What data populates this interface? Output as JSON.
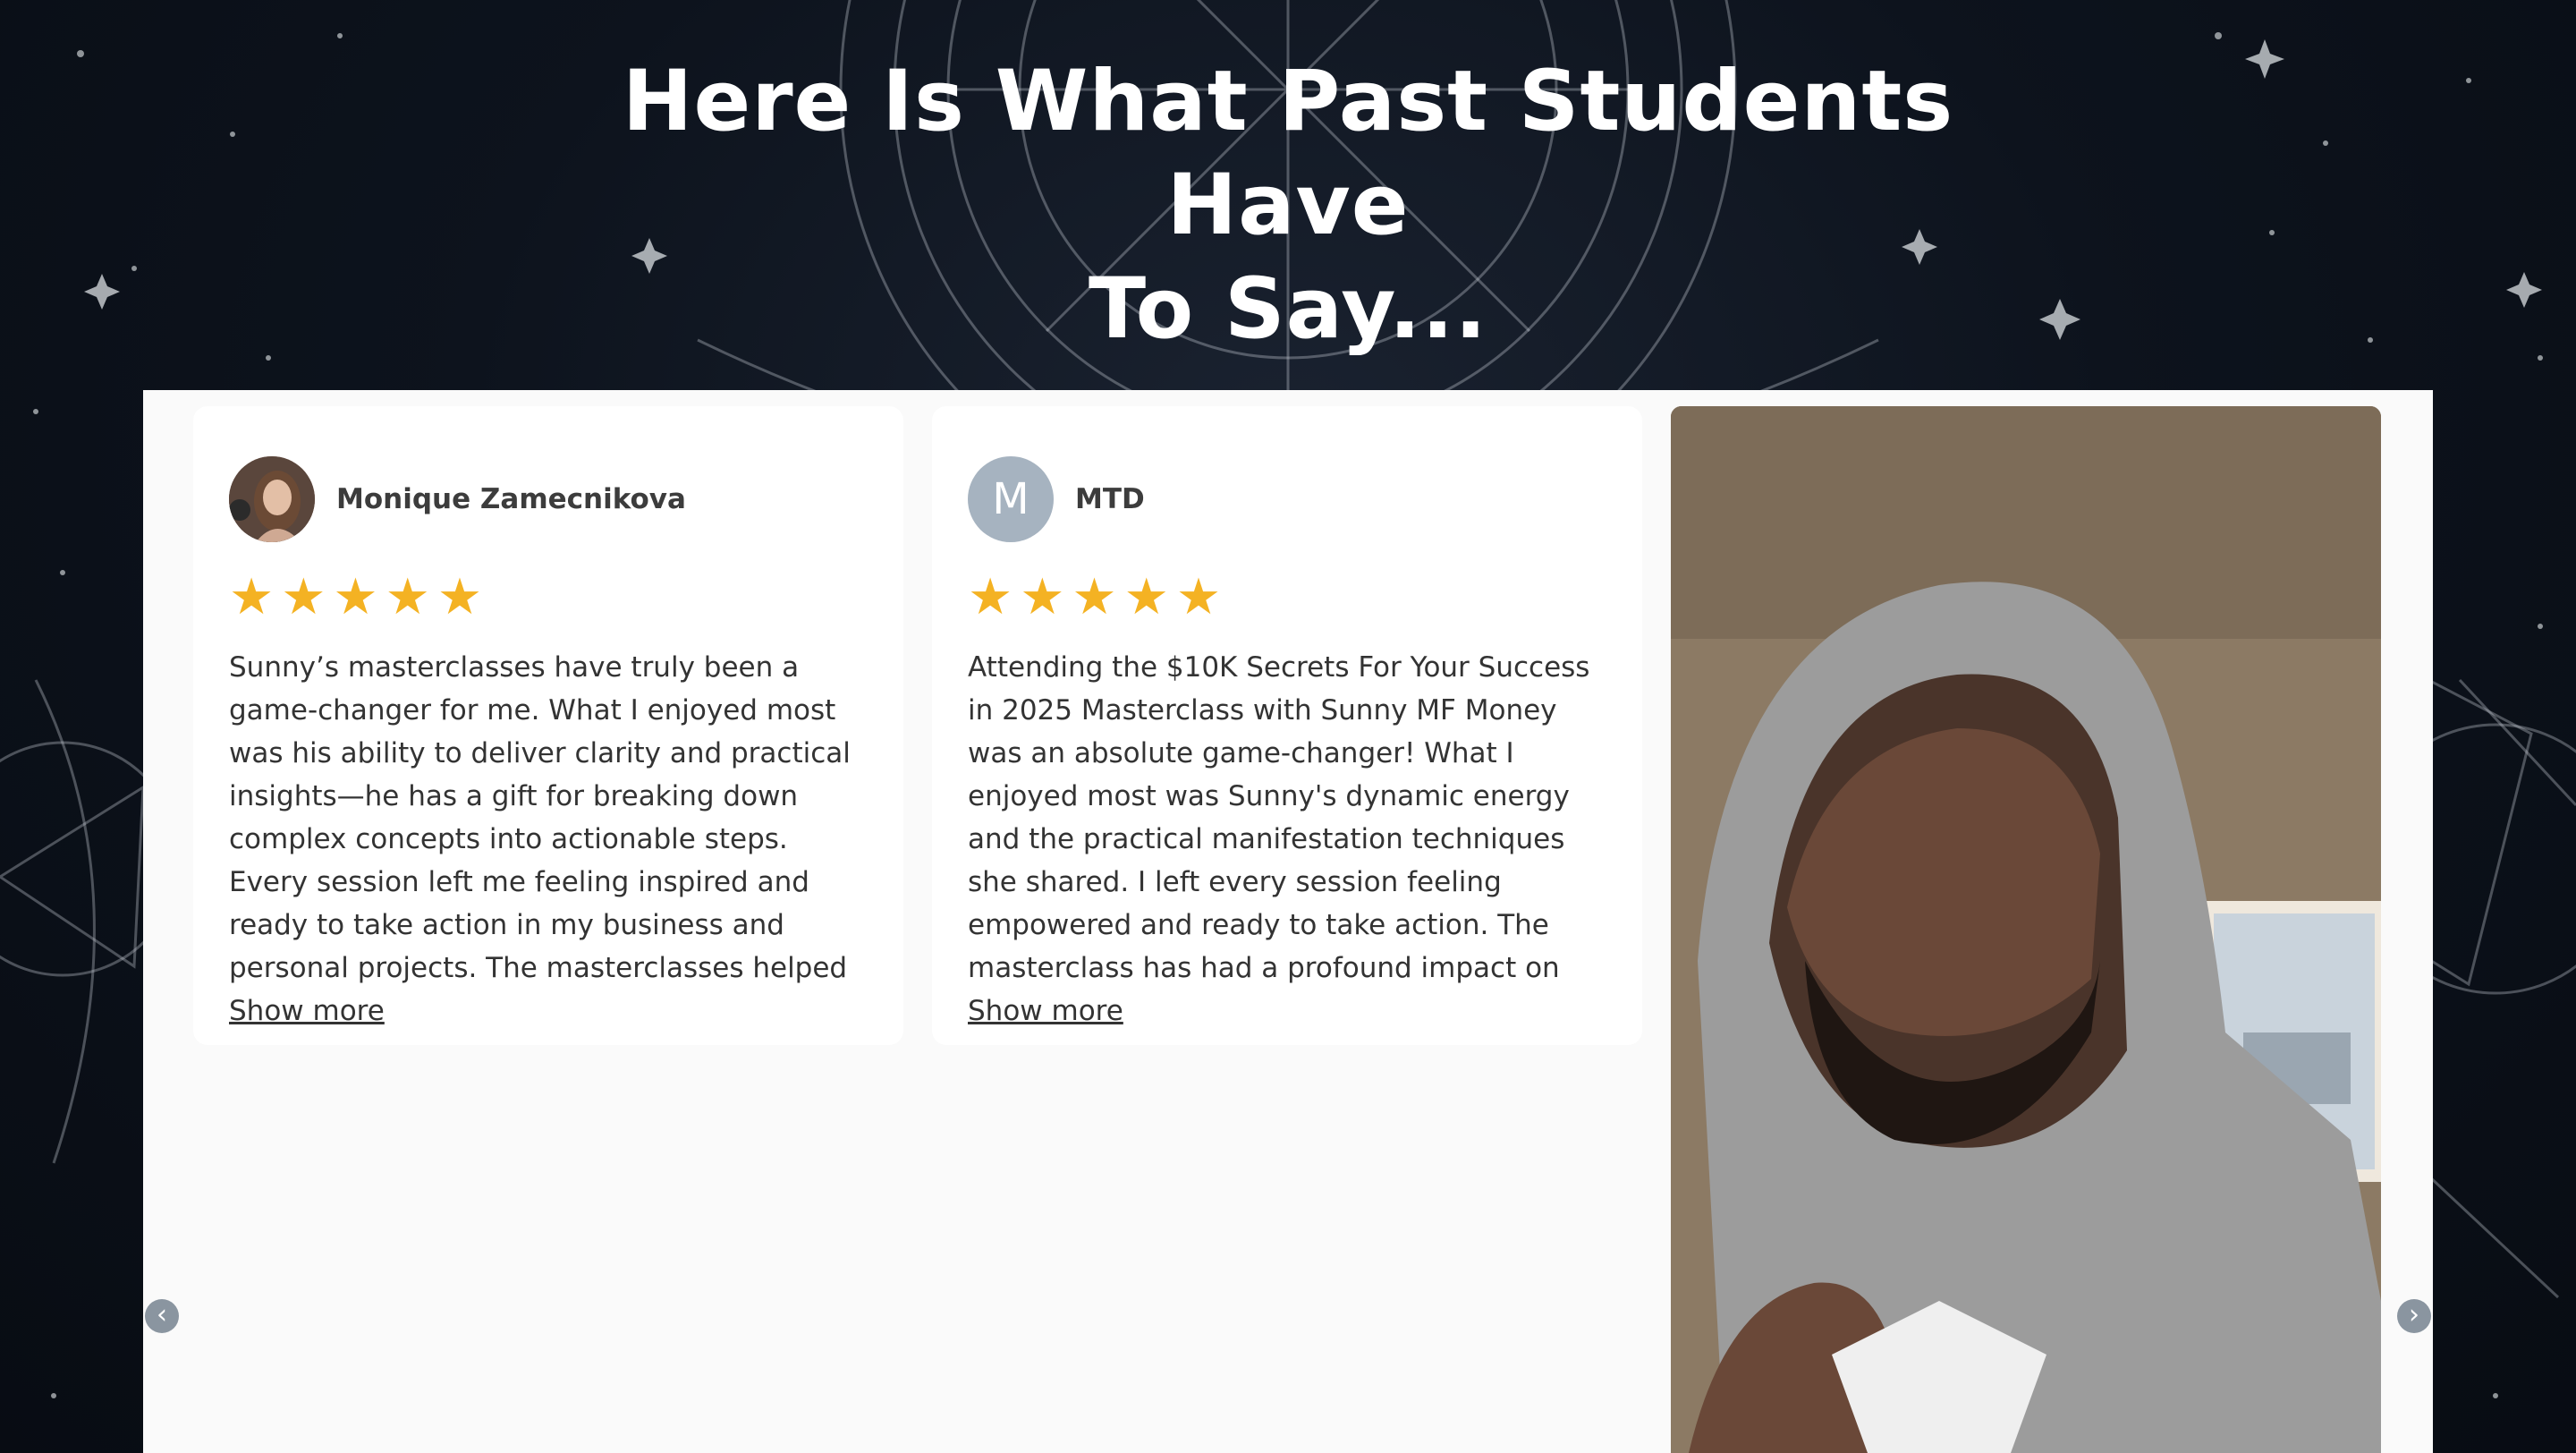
{
  "heading": {
    "line1": "Here Is What Past Students Have",
    "line2": "To Say..."
  },
  "reviews": [
    {
      "name": "Monique Zamecnikova",
      "avatar": "photo",
      "rating": 5,
      "stars": "★",
      "text": "Sunny’s masterclasses have truly been a game-changer for me. What I enjoyed most was his ability to deliver clarity and practical insights—he has a gift for breaking down complex concepts into actionable steps. Every session left me feeling inspired and ready to take action in my business and personal projects. The masterclasses helped me build confidence in...",
      "show_more": "Show more"
    },
    {
      "name": "MTD",
      "avatar": "letter",
      "avatar_letter": "M",
      "rating": 5,
      "stars": "★",
      "text": "Attending the $10K Secrets For Your Success in 2025 Masterclass with Sunny MF Money was an absolute game-changer! What I enjoyed most was Sunny's dynamic energy and the practical manifestation techniques she shared. I left every session feeling empowered and ready to take action. The masterclass has had a profound impact on my business. Since implementing...",
      "show_more": "Show more"
    }
  ],
  "video_testimonial": {
    "type": "video-thumbnail"
  },
  "carousel": {
    "prev_icon": "‹",
    "next_icon": "›"
  },
  "colors": {
    "background": "#0b111b",
    "panel": "#fafafa",
    "card": "#ffffff",
    "star": "#f4b223",
    "heading": "#ffffff",
    "avatar_letter_bg": "#a6b3c0",
    "arrow_bg": "#8a95a0"
  }
}
